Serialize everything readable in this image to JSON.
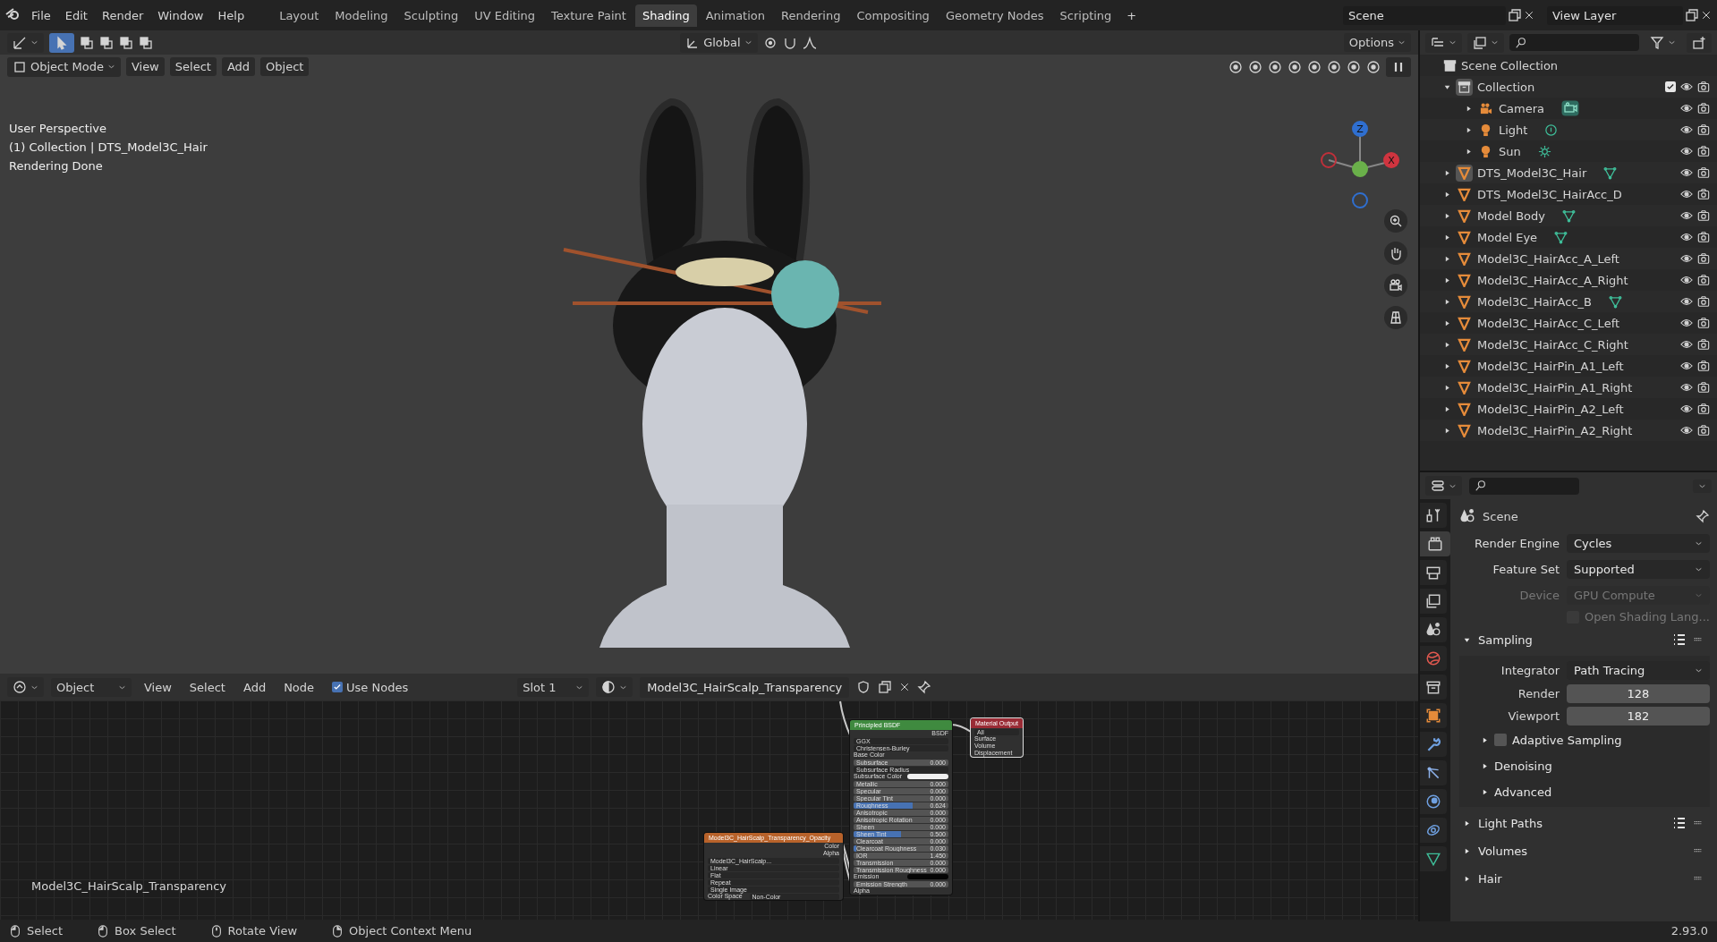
{
  "top_bar": {
    "menus": [
      "File",
      "Edit",
      "Render",
      "Window",
      "Help"
    ],
    "workspaces": [
      {
        "label": "Layout",
        "selected": false
      },
      {
        "label": "Modeling",
        "selected": false
      },
      {
        "label": "Sculpting",
        "selected": false
      },
      {
        "label": "UV Editing",
        "selected": false
      },
      {
        "label": "Texture Paint",
        "selected": false
      },
      {
        "label": "Shading",
        "selected": true
      },
      {
        "label": "Animation",
        "selected": false
      },
      {
        "label": "Rendering",
        "selected": false
      },
      {
        "label": "Compositing",
        "selected": false
      },
      {
        "label": "Geometry Nodes",
        "selected": false
      },
      {
        "label": "Scripting",
        "selected": false
      }
    ],
    "add_workspace": "+",
    "scene": "Scene",
    "view_layer": "View Layer"
  },
  "viewport": {
    "orientation": "Global",
    "options": "Options",
    "mode": "Object Mode",
    "menus": [
      "View",
      "Select",
      "Add",
      "Object"
    ],
    "overlay_text": [
      "User Perspective",
      "(1) Collection | DTS_Model3C_Hair",
      "Rendering Done"
    ],
    "gizmo_axes": [
      {
        "label": "Z",
        "color": "#2f6fd0"
      },
      {
        "label": "X",
        "color": "#d0343f"
      }
    ]
  },
  "node_editor": {
    "editor_type": "Object",
    "menus": [
      "View",
      "Select",
      "Add",
      "Node"
    ],
    "use_nodes": {
      "label": "Use Nodes",
      "checked": true
    },
    "slot": "Slot 1",
    "material": "Model3C_HairScalp_Transparency",
    "material_label": "Model3C_HairScalp_Transparency",
    "principled": {
      "title": "Principled BSDF",
      "rows": [
        {
          "kind": "output",
          "label": "BSDF"
        },
        {
          "kind": "dropdown",
          "label": "GGX"
        },
        {
          "kind": "dropdown",
          "label": "Christensen-Burley"
        },
        {
          "kind": "socket",
          "label": "Base Color"
        },
        {
          "kind": "number",
          "label": "Subsurface",
          "value": "0.000"
        },
        {
          "kind": "dropdown",
          "label": "Subsurface Radius"
        },
        {
          "kind": "color",
          "label": "Subsurface Color",
          "color": "#f0f0f0"
        },
        {
          "kind": "number",
          "label": "Metallic",
          "value": "0.000"
        },
        {
          "kind": "number",
          "label": "Specular",
          "value": "0.000"
        },
        {
          "kind": "number",
          "label": "Specular Tint",
          "value": "0.000"
        },
        {
          "kind": "slider",
          "label": "Roughness",
          "value": "0.624",
          "level": 0.624
        },
        {
          "kind": "number",
          "label": "Anisotropic",
          "value": "0.000"
        },
        {
          "kind": "number",
          "label": "Anisotropic Rotation",
          "value": "0.000"
        },
        {
          "kind": "number",
          "label": "Sheen",
          "value": "0.000"
        },
        {
          "kind": "slider",
          "label": "Sheen Tint",
          "value": "0.500",
          "level": 0.5
        },
        {
          "kind": "number",
          "label": "Clearcoat",
          "value": "0.000"
        },
        {
          "kind": "slider",
          "label": "Clearcoat Roughness",
          "value": "0.030",
          "level": 0.03
        },
        {
          "kind": "number",
          "label": "IOR",
          "value": "1.450"
        },
        {
          "kind": "number",
          "label": "Transmission",
          "value": "0.000"
        },
        {
          "kind": "number",
          "label": "Transmission Roughness",
          "value": "0.000"
        },
        {
          "kind": "color",
          "label": "Emission",
          "color": "#050505"
        },
        {
          "kind": "number",
          "label": "Emission Strength",
          "value": "0.000"
        },
        {
          "kind": "socket",
          "label": "Alpha"
        }
      ]
    },
    "output_node": {
      "title": "Material Output",
      "target": "All",
      "inputs": [
        "Surface",
        "Volume",
        "Displacement"
      ]
    },
    "image_node": {
      "title": "Model3C_HairScalp_Transparency_Opacity",
      "outputs": [
        "Color",
        "Alpha"
      ],
      "image": "Model3C_HairScalp...",
      "options": [
        "Linear",
        "Flat",
        "Repeat",
        "Single Image"
      ],
      "color_space_label": "Color Space",
      "color_space": "Non-Color"
    }
  },
  "outliner": {
    "root": "Scene Collection",
    "items": [
      {
        "name": "Collection",
        "kind": "collection",
        "expanded": true,
        "active": true,
        "checked": true,
        "children": [
          {
            "name": "Camera",
            "kind": "camera",
            "expanded": false,
            "active": false,
            "data": {
              "kind": "camera"
            }
          },
          {
            "name": "Light",
            "kind": "light",
            "expanded": false,
            "active": false,
            "data": {
              "kind": "point"
            }
          },
          {
            "name": "Sun",
            "kind": "light",
            "expanded": false,
            "active": false,
            "data": {
              "kind": "sun"
            }
          }
        ]
      },
      {
        "name": "DTS_Model3C_Hair",
        "kind": "mesh",
        "expanded": false,
        "active": true,
        "data": {
          "kind": "mesh"
        }
      },
      {
        "name": "DTS_Model3C_HairAcc_D",
        "kind": "mesh",
        "expanded": false,
        "active": false
      },
      {
        "name": "Model Body",
        "kind": "mesh",
        "expanded": false,
        "active": false,
        "data": {
          "kind": "mesh"
        }
      },
      {
        "name": "Model Eye",
        "kind": "mesh",
        "expanded": false,
        "active": false,
        "data": {
          "kind": "mesh"
        }
      },
      {
        "name": "Model3C_HairAcc_A_Left",
        "kind": "mesh",
        "expanded": false,
        "active": false
      },
      {
        "name": "Model3C_HairAcc_A_Right",
        "kind": "mesh",
        "expanded": false,
        "active": false
      },
      {
        "name": "Model3C_HairAcc_B",
        "kind": "mesh",
        "expanded": false,
        "active": false,
        "data": {
          "kind": "mesh"
        }
      },
      {
        "name": "Model3C_HairAcc_C_Left",
        "kind": "mesh",
        "expanded": false,
        "active": false
      },
      {
        "name": "Model3C_HairAcc_C_Right",
        "kind": "mesh",
        "expanded": false,
        "active": false
      },
      {
        "name": "Model3C_HairPin_A1_Left",
        "kind": "mesh",
        "expanded": false,
        "active": false
      },
      {
        "name": "Model3C_HairPin_A1_Right",
        "kind": "mesh",
        "expanded": false,
        "active": false
      },
      {
        "name": "Model3C_HairPin_A2_Left",
        "kind": "mesh",
        "expanded": false,
        "active": false
      },
      {
        "name": "Model3C_HairPin_A2_Right",
        "kind": "mesh",
        "expanded": false,
        "active": false
      }
    ]
  },
  "properties": {
    "tabs": [
      {
        "kind": "tool",
        "selected": false
      },
      {
        "kind": "render",
        "selected": true
      },
      {
        "kind": "output",
        "selected": false
      },
      {
        "kind": "view_layer",
        "selected": false
      },
      {
        "kind": "scene",
        "selected": false
      },
      {
        "kind": "world",
        "selected": false
      },
      {
        "kind": "collection",
        "selected": false
      },
      {
        "kind": "object",
        "selected": false
      },
      {
        "kind": "modifier",
        "selected": false
      },
      {
        "kind": "particles",
        "selected": false
      },
      {
        "kind": "physics",
        "selected": false
      },
      {
        "kind": "constraints",
        "selected": false
      },
      {
        "kind": "data",
        "selected": false
      }
    ],
    "context": "Scene",
    "fields": [
      {
        "kind": "dropdown",
        "label": "Render Engine",
        "value": "Cycles",
        "disabled": false
      },
      {
        "kind": "dropdown",
        "label": "Feature Set",
        "value": "Supported",
        "disabled": false
      },
      {
        "kind": "dropdown",
        "label": "Device",
        "value": "GPU Compute",
        "disabled": true
      },
      {
        "kind": "checkbox",
        "value": "Open Shading Lang...",
        "checked": false,
        "disabled": true
      }
    ],
    "panels": [
      {
        "title": "Sampling",
        "expanded": true,
        "presets": true,
        "fields": [
          {
            "kind": "dropdown",
            "label": "Integrator",
            "value": "Path Tracing"
          },
          {
            "kind": "number",
            "label": "Render",
            "value": "128"
          },
          {
            "kind": "number",
            "label": "Viewport",
            "value": "182"
          }
        ],
        "subpanels": [
          {
            "title": "Adaptive Sampling",
            "checkbox": true,
            "checked": false
          },
          {
            "title": "Denoising",
            "checkbox": false
          },
          {
            "title": "Advanced",
            "checkbox": false
          }
        ]
      },
      {
        "title": "Light Paths",
        "expanded": false,
        "presets": true
      },
      {
        "title": "Volumes",
        "expanded": false,
        "presets": false
      },
      {
        "title": "Hair",
        "expanded": false,
        "presets": false
      }
    ]
  },
  "status_bar": {
    "items": [
      {
        "kind": "left",
        "label": "Select"
      },
      {
        "kind": "drag",
        "label": "Box Select"
      },
      {
        "kind": "middle",
        "label": "Rotate View"
      },
      {
        "kind": "right",
        "label": "Object Context Menu"
      }
    ],
    "version": "2.93.0"
  }
}
